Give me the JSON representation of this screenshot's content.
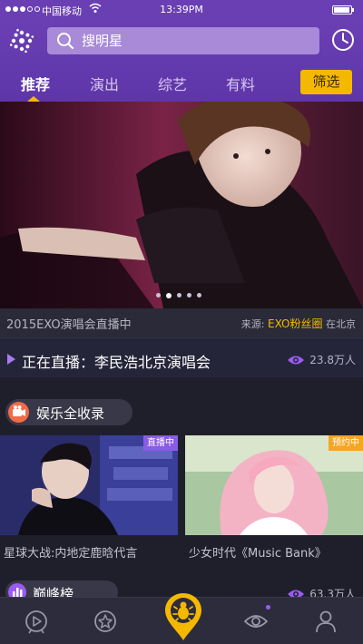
{
  "status_bar": {
    "carrier": "中国移动",
    "time": "13:39PM"
  },
  "header": {
    "search_placeholder": "搜明星"
  },
  "tabs": [
    {
      "label": "推荐",
      "active": true
    },
    {
      "label": "演出",
      "active": false
    },
    {
      "label": "综艺",
      "active": false
    },
    {
      "label": "有料",
      "active": false
    }
  ],
  "filter_label": "筛选",
  "banner": {
    "title": "2015EXO演唱会直播中",
    "source_prefix": "来源:",
    "source_name": "EXO粉丝圈",
    "location": "在北京",
    "page_count": 5,
    "active_page": 1
  },
  "live": {
    "text": "正在直播：李民浩北京演唱会",
    "viewers": "23.8万人"
  },
  "section": {
    "label": "娱乐全收录"
  },
  "cards": [
    {
      "title": "星球大战:内地定鹿晗代言",
      "badge": "直播中",
      "badge_color": "#8a5be6"
    },
    {
      "title": "少女时代《Music Bank》",
      "badge": "预约中",
      "badge_color": "#f5a623"
    }
  ],
  "ranking": {
    "label": "巅峰榜",
    "viewers": "63.3万人"
  },
  "colors": {
    "accent_purple": "#6a3fb4",
    "accent_yellow": "#f5b800"
  },
  "tabbar": [
    {
      "icon": "play-circle-icon"
    },
    {
      "icon": "star-icon"
    },
    {
      "icon": "bug-center-icon"
    },
    {
      "icon": "eye-icon"
    },
    {
      "icon": "person-icon"
    }
  ]
}
